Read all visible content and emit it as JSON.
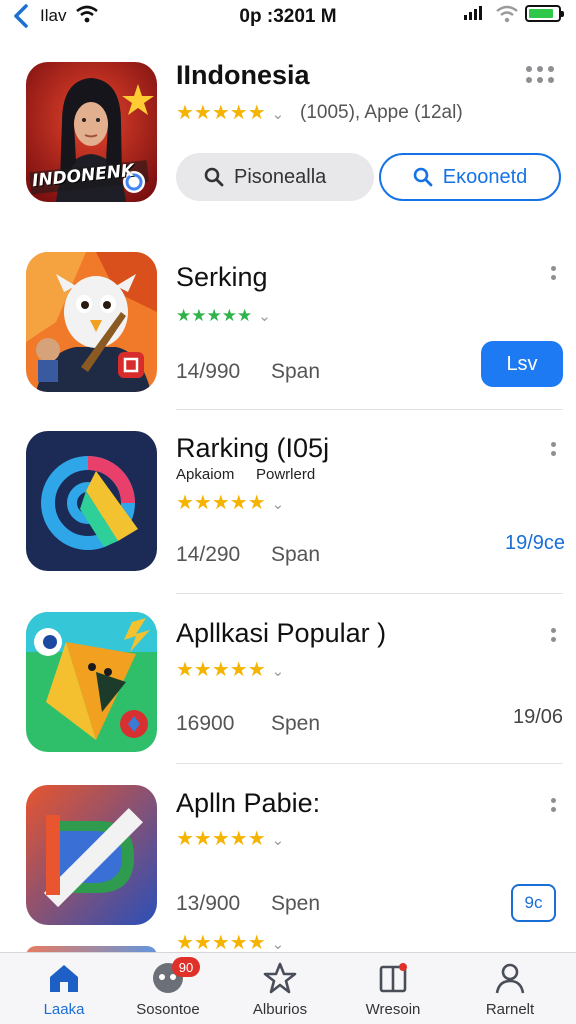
{
  "status_bar": {
    "carrier": "Ilav",
    "time": "0p :3201 M",
    "battery_color": "#2ec84a"
  },
  "apps": [
    {
      "title": "IIndonesia",
      "rating_text": "(1005), Appe (12al)",
      "icon_text": "INDONENK",
      "secondary_button": "Pisonealla",
      "primary_button": "Eκoonetd"
    },
    {
      "title": "Serking",
      "size": "14/990",
      "span": "Span",
      "button": "Lsv"
    },
    {
      "title": "Rarking (I05j",
      "subtitle_left": "Apkaiom",
      "subtitle_right": "Powrlerd",
      "size": "14/290",
      "span": "Span",
      "price": "19/9ce"
    },
    {
      "title": "Apllkasi  Popular )",
      "size": "16900",
      "span": "Spen",
      "price": "19/06"
    },
    {
      "title": "Aplln Pabie:",
      "size": "13/900",
      "span": "Spen",
      "button": "9c"
    }
  ],
  "tab_bar": {
    "tabs": [
      {
        "label": "Laaka",
        "icon": "home-icon",
        "active": true
      },
      {
        "label": "Sosontoe",
        "icon": "games-icon",
        "badge": "90"
      },
      {
        "label": "Alburios",
        "icon": "star-apps-icon"
      },
      {
        "label": "Wresoin",
        "icon": "book-icon"
      },
      {
        "label": "Rarnelt",
        "icon": "person-icon"
      }
    ]
  },
  "colors": {
    "accent": "#1d7af2",
    "star": "#f4b400",
    "star_green": "#2fb34a",
    "badge": "#e0302a"
  }
}
